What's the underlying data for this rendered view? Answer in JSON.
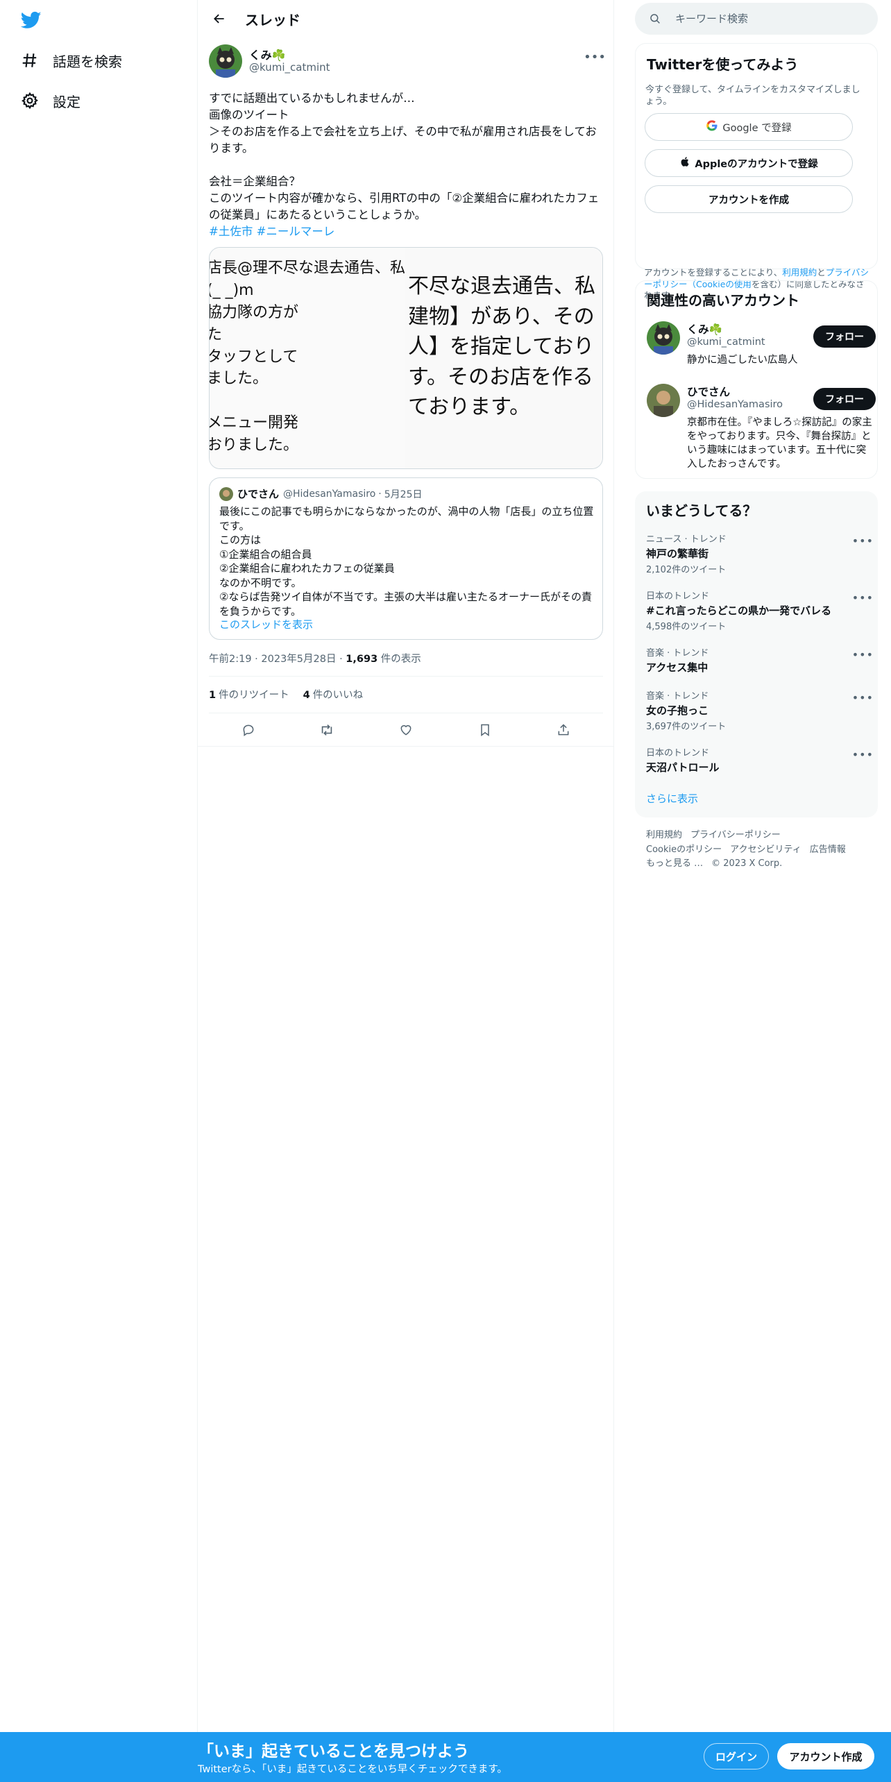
{
  "colors": {
    "brand": "#1d9bf0",
    "text": "#0f1419",
    "muted": "#536471"
  },
  "nav": {
    "items": [
      {
        "label": "話題を検索",
        "icon": "hashtag-icon"
      },
      {
        "label": "設定",
        "icon": "gear-icon"
      }
    ]
  },
  "header": {
    "title": "スレッド"
  },
  "tweet": {
    "name": "くみ☘️",
    "handle": "@kumi_catmint",
    "text": "すでに話題出ているかもしれませんが…\n画像のツイート\n＞そのお店を作る上で会社を立ち上げ、その中で私が雇用され店長をしております。\n\n会社＝企業組合？\nこのツイート内容が確かなら、引用RTの中の「②企業組合に雇われたカフェの従業員」にあたるということしょうか。",
    "hashtags": [
      "#土佐市",
      "#ニールマーレ"
    ],
    "media": {
      "left_lines": "店長@理不尽な退去通告、私\n(_ _)m\n協力隊の方が\nた\nタッフとして\nました。\n\nメニュー開発\nおりました。",
      "right_lines": "不尽な退去通告、私\n建物】があり、その\n人】を指定しており\nす。そのお店を作る\nております。"
    },
    "time": "午前2:19",
    "date": "2023年5月28日",
    "views": "1,693",
    "views_label": "件の表示",
    "retweets": "1",
    "retweets_label": "件のリツイート",
    "likes": "4",
    "likes_label": "件のいいね"
  },
  "quote": {
    "name": "ひでさん",
    "handle": "@HidesanYamasiro",
    "date": "5月25日",
    "text": "最後にこの記事でも明らかにならなかったのが、渦中の人物「店長」の立ち位置です。\nこの方は\n①企業組合の組合員\n②企業組合に雇われたカフェの従業員\nなのか不明です。\n②ならば告発ツイ自体が不当です。主張の大半は雇い主たるオーナー氏がその責を負うからです。",
    "link": "このスレッドを表示"
  },
  "search": {
    "placeholder": "キーワード検索"
  },
  "signup": {
    "title": "Twitterを使ってみよう",
    "subtitle": "今すぐ登録して、タイムラインをカスタマイズしましょう。",
    "google": "Google で登録",
    "apple": "Appleのアカウントで登録",
    "create": "アカウントを作成",
    "legal_prefix": "アカウントを登録することにより、",
    "legal_terms": "利用規約",
    "legal_and": "と",
    "legal_privacy": "プライバシーポリシー（Cookieの使用",
    "legal_suffix": "を含む）に同意したとみなされます。"
  },
  "related": {
    "title": "関連性の高いアカウント",
    "follow": "フォロー",
    "accounts": [
      {
        "name": "くみ☘️",
        "handle": "@kumi_catmint",
        "bio": "静かに過ごしたい広島人"
      },
      {
        "name": "ひでさん",
        "handle": "@HidesanYamasiro",
        "bio": "京都市在住。『やましろ☆探訪記』の家主をやっております。只今、『舞台探訪』という趣味にはまっています。五十代に突入したおっさんです。"
      }
    ]
  },
  "trends": {
    "title": "いまどうしてる？",
    "items": [
      {
        "category": "ニュース · トレンド",
        "name": "神戸の繁華街",
        "count": "2,102件のツイート"
      },
      {
        "category": "日本のトレンド",
        "name": "#これ言ったらどこの県か一発でバレる",
        "count": "4,598件のツイート"
      },
      {
        "category": "音楽 · トレンド",
        "name": "アクセス集中",
        "count": ""
      },
      {
        "category": "音楽 · トレンド",
        "name": "女の子抱っこ",
        "count": "3,697件のツイート"
      },
      {
        "category": "日本のトレンド",
        "name": "天沼パトロール",
        "count": ""
      }
    ],
    "more": "さらに表示"
  },
  "footer": {
    "links": [
      "利用規約",
      "プライバシーポリシー",
      "Cookieのポリシー",
      "アクセシビリティ",
      "広告情報",
      "もっと見る …",
      "© 2023 X Corp."
    ]
  },
  "banner": {
    "title": "「いま」起きていることを見つけよう",
    "subtitle": "Twitterなら、「いま」起きていることをいち早くチェックできます。",
    "login": "ログイン",
    "signup": "アカウント作成"
  }
}
